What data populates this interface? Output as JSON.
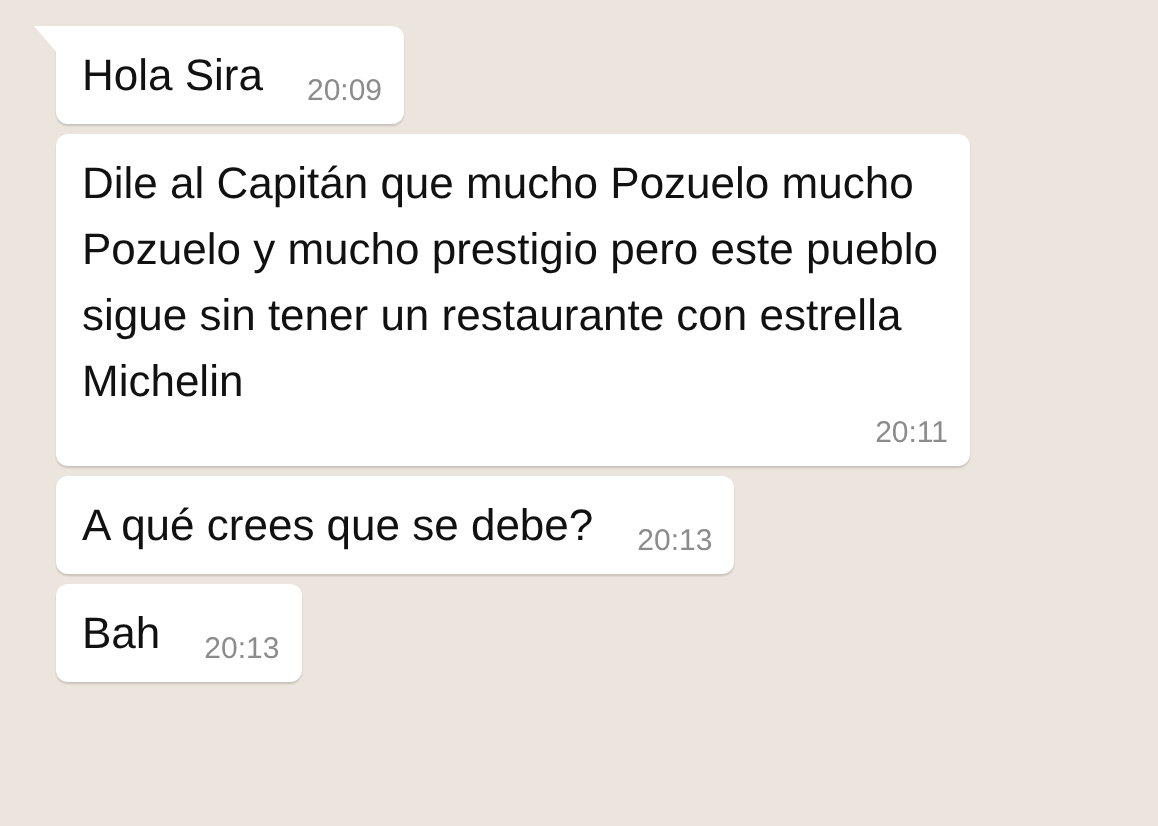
{
  "messages": [
    {
      "text": "Hola Sira",
      "time": "20:09",
      "tail": true
    },
    {
      "text": "Dile al Capitán que mucho Pozuelo mucho Pozuelo y mucho prestigio pero este pueblo sigue sin tener un restaurante con estrella Michelin",
      "time": "20:11",
      "tail": false
    },
    {
      "text": "A qué crees que se debe?",
      "time": "20:13",
      "tail": false
    },
    {
      "text": "Bah",
      "time": "20:13",
      "tail": false
    }
  ]
}
